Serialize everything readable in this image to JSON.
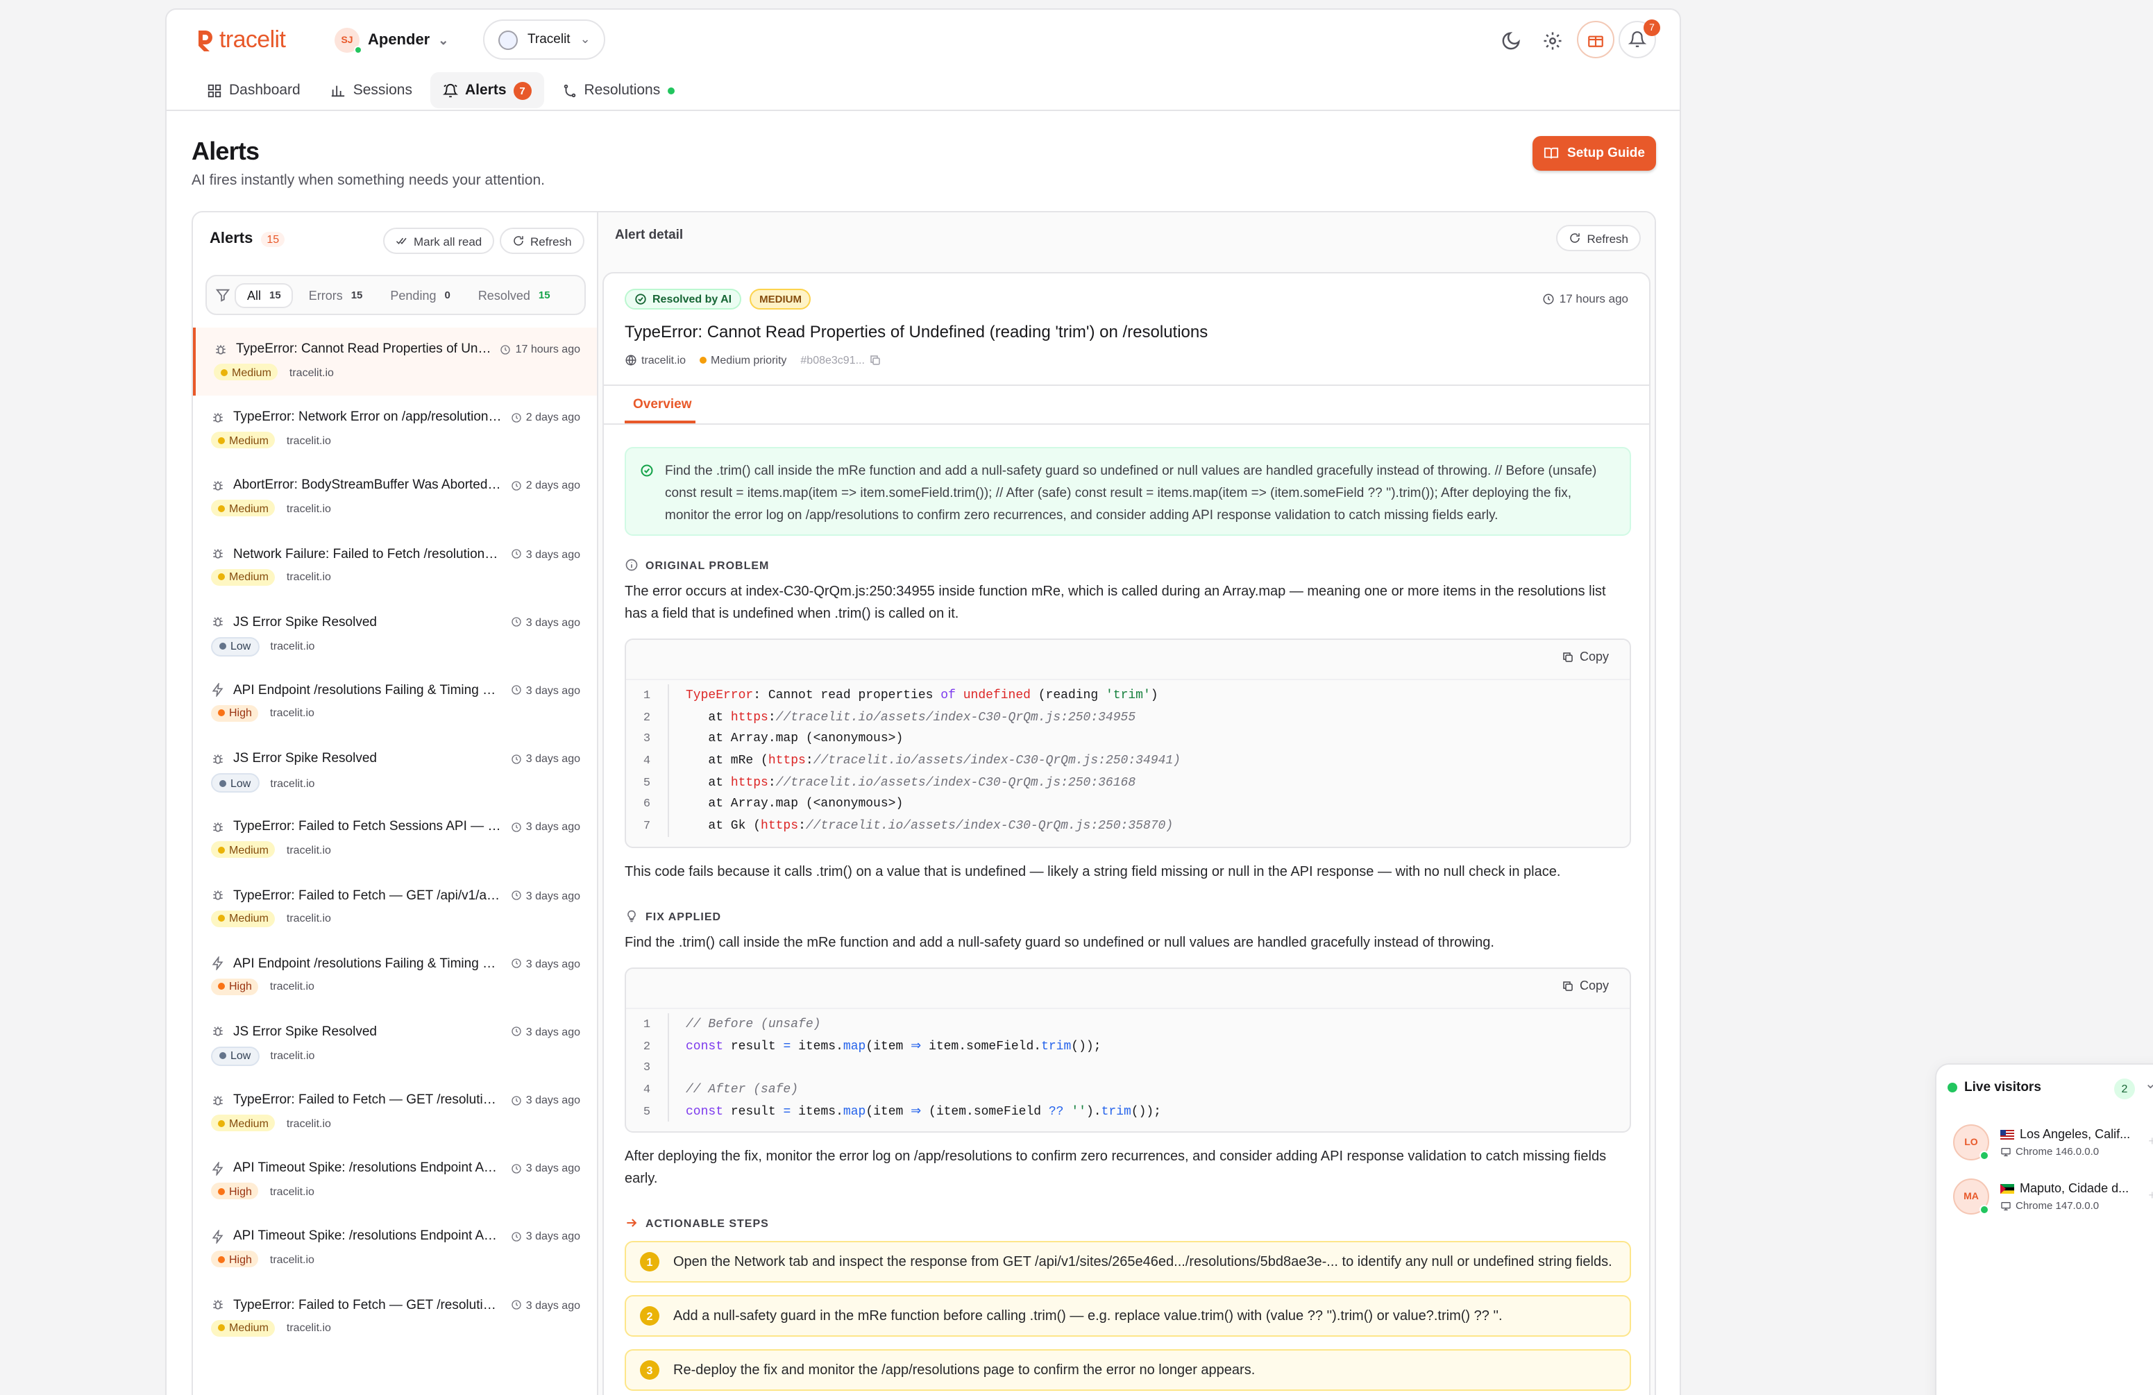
{
  "app": {
    "logo_text": "tracelit",
    "brand_color": "#e8592a"
  },
  "workspace": {
    "initials": "SJ",
    "name": "Apender"
  },
  "site_selector": {
    "label": "Tracelit"
  },
  "header_icons": [
    "moon-icon",
    "gear-icon",
    "gift-icon",
    "bell-icon"
  ],
  "notifications": {
    "count": "7"
  },
  "nav": {
    "dashboard": "Dashboard",
    "sessions": "Sessions",
    "alerts": "Alerts",
    "alerts_badge": "7",
    "resolutions": "Resolutions"
  },
  "page": {
    "title": "Alerts",
    "subtitle": "AI fires instantly when something needs your attention.",
    "setup_label": "Setup Guide"
  },
  "alerts_panel": {
    "title": "Alerts",
    "count": "15",
    "mark_all_read": "Mark all read",
    "refresh": "Refresh",
    "filters": [
      {
        "label": "All",
        "count": "15"
      },
      {
        "label": "Errors",
        "count": "15"
      },
      {
        "label": "Pending",
        "count": "0"
      },
      {
        "label": "Resolved",
        "count": "15"
      }
    ],
    "items": [
      {
        "icon": "bug-icon",
        "title": "TypeError: Cannot Read Properties of Undefi...",
        "time": "17 hours ago",
        "severity": "Medium",
        "site": "tracelit.io"
      },
      {
        "icon": "bug-icon",
        "title": "TypeError: Network Error on /app/resolutions ...",
        "time": "2 days ago",
        "severity": "Medium",
        "site": "tracelit.io"
      },
      {
        "icon": "bug-icon",
        "title": "AbortError: BodyStreamBuffer Was Aborted o...",
        "time": "2 days ago",
        "severity": "Medium",
        "site": "tracelit.io"
      },
      {
        "icon": "bug-icon",
        "title": "Network Failure: Failed to Fetch /resolutions A...",
        "time": "3 days ago",
        "severity": "Medium",
        "site": "tracelit.io"
      },
      {
        "icon": "bug-icon",
        "title": "JS Error Spike Resolved",
        "time": "3 days ago",
        "severity": "Low",
        "site": "tracelit.io"
      },
      {
        "icon": "bolt-icon",
        "title": "API Endpoint /resolutions Failing & Timing Out...",
        "time": "3 days ago",
        "severity": "High",
        "site": "tracelit.io"
      },
      {
        "icon": "bug-icon",
        "title": "JS Error Spike Resolved",
        "time": "3 days ago",
        "severity": "Low",
        "site": "tracelit.io"
      },
      {
        "icon": "bug-icon",
        "title": "TypeError: Failed to Fetch Sessions API — Net...",
        "time": "3 days ago",
        "severity": "Medium",
        "site": "tracelit.io"
      },
      {
        "icon": "bug-icon",
        "title": "TypeError: Failed to Fetch — GET /api/v1/auth/...",
        "time": "3 days ago",
        "severity": "Medium",
        "site": "tracelit.io"
      },
      {
        "icon": "bolt-icon",
        "title": "API Endpoint /resolutions Failing & Timing Out...",
        "time": "3 days ago",
        "severity": "High",
        "site": "tracelit.io"
      },
      {
        "icon": "bug-icon",
        "title": "JS Error Spike Resolved",
        "time": "3 days ago",
        "severity": "Low",
        "site": "tracelit.io"
      },
      {
        "icon": "bug-icon",
        "title": "TypeError: Failed to Fetch — GET /resolutions ...",
        "time": "3 days ago",
        "severity": "Medium",
        "site": "tracelit.io"
      },
      {
        "icon": "bolt-icon",
        "title": "API Timeout Spike: /resolutions Endpoint Aver...",
        "time": "3 days ago",
        "severity": "High",
        "site": "tracelit.io"
      },
      {
        "icon": "bolt-icon",
        "title": "API Timeout Spike: /resolutions Endpoint Aver...",
        "time": "3 days ago",
        "severity": "High",
        "site": "tracelit.io"
      },
      {
        "icon": "bug-icon",
        "title": "TypeError: Failed to Fetch — GET /resolutions ...",
        "time": "3 days ago",
        "severity": "Medium",
        "site": "tracelit.io"
      }
    ]
  },
  "detail": {
    "header": "Alert detail",
    "refresh": "Refresh",
    "status": "Resolved by AI",
    "severity": "MEDIUM",
    "time": "17 hours ago",
    "title": "TypeError: Cannot Read Properties of Undefined (reading 'trim') on /resolutions",
    "site": "tracelit.io",
    "priority": "Medium priority",
    "hash": "#b08e3c91...",
    "tab": "Overview",
    "summary": "Find the .trim() call inside the mRe function and add a null-safety guard so undefined or null values are handled gracefully instead of throwing. // Before (unsafe) const result = items.map(item => item.someField.trim()); // After (safe) const result = items.map(item => (item.someField ?? '').trim()); After deploying the fix, monitor the error log on /app/resolutions to confirm zero recurrences, and consider adding API response validation to catch missing fields early.",
    "original_heading": "ORIGINAL PROBLEM",
    "original_text": "The error occurs at index-C30-QrQm.js:250:34955 inside function mRe, which is called during an Array.map — meaning one or more items in the resolutions list has a field that is undefined when .trim() is called on it.",
    "copy": "Copy",
    "trace_nums": [
      "1",
      "2",
      "3",
      "4",
      "5",
      "6",
      "7"
    ],
    "trace_after": "This code fails because it calls .trim() on a value that is undefined — likely a string field missing or null in the API response — with no null check in place.",
    "fix_heading": "FIX APPLIED",
    "fix_text": "Find the .trim() call inside the mRe function and add a null-safety guard so undefined or null values are handled gracefully instead of throwing.",
    "fix_nums": [
      "1",
      "2",
      "3",
      "4",
      "5"
    ],
    "after_fix": "After deploying the fix, monitor the error log on /app/resolutions to confirm zero recurrences, and consider adding API response validation to catch missing fields early.",
    "steps_heading": "ACTIONABLE STEPS",
    "steps": [
      {
        "n": "1",
        "text": "Open the Network tab and inspect the response from GET /api/v1/sites/265e46ed.../resolutions/5bd8ae3e-... to identify any null or undefined string fields."
      },
      {
        "n": "2",
        "text": "Add a null-safety guard in the mRe function before calling .trim() — e.g. replace value.trim() with (value ?? '').trim() or value?.trim() ?? ''."
      },
      {
        "n": "3",
        "text": "Re-deploy the fix and monitor the /app/resolutions page to confirm the error no longer appears."
      }
    ]
  },
  "live": {
    "title": "Live visitors",
    "count": "2",
    "visitors": [
      {
        "initials": "LO",
        "location": "Los Angeles, Calif...",
        "browser": "Chrome 146.0.0.0",
        "flag": "us-flag-icon"
      },
      {
        "initials": "MA",
        "location": "Maputo, Cidade d...",
        "browser": "Chrome 147.0.0.0",
        "flag": "mz-flag-icon"
      }
    ]
  }
}
